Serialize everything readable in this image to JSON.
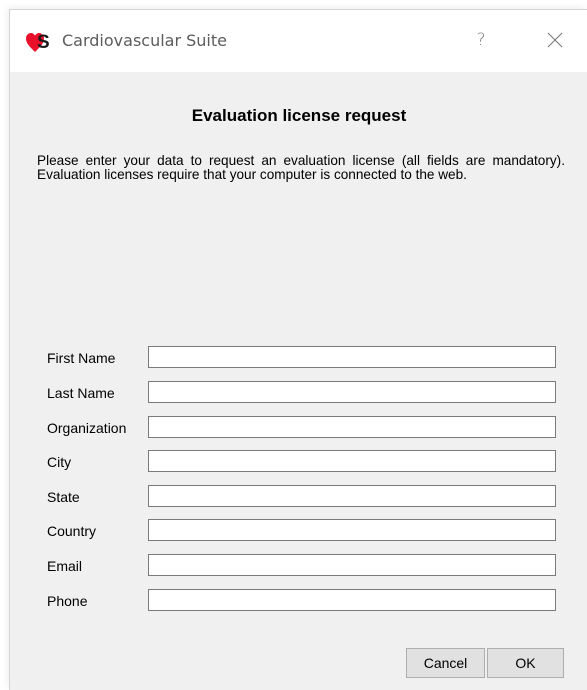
{
  "window": {
    "title": "Cardiovascular Suite",
    "logo_text": "S",
    "help_label": "?"
  },
  "dialog": {
    "heading": "Evaluation license request",
    "intro": "Please enter your data to request an evaluation license (all fields are mandatory). Evaluation licenses require that your computer is connected to the web."
  },
  "form": {
    "fields": [
      {
        "label": "First Name",
        "value": ""
      },
      {
        "label": "Last Name",
        "value": ""
      },
      {
        "label": "Organization",
        "value": ""
      },
      {
        "label": "City",
        "value": ""
      },
      {
        "label": "State",
        "value": ""
      },
      {
        "label": "Country",
        "value": ""
      },
      {
        "label": "Email",
        "value": ""
      },
      {
        "label": "Phone",
        "value": ""
      }
    ]
  },
  "buttons": {
    "cancel": "Cancel",
    "ok": "OK"
  },
  "colors": {
    "brand": "#e8102a",
    "dialog_bg": "#f0f0f0"
  }
}
